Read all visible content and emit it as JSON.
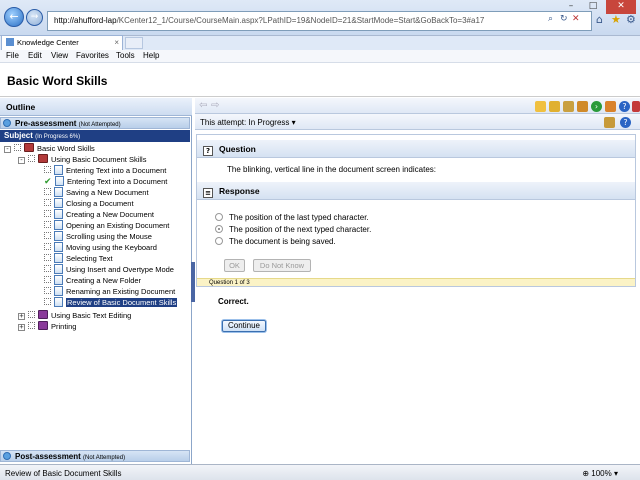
{
  "browser": {
    "url_host": "http://ahufford-lap",
    "url_rest": "/KCenter12_1/Course/CourseMain.aspx?LPathID=19&NodeID=21&StartMode=Start&GoBackTo=3#a17",
    "back_glyph": "←",
    "forward_glyph": "→",
    "tab_title": "Knowledge Center",
    "tab_close": "×",
    "window_controls": [
      "–",
      "□",
      "✕"
    ],
    "chrome_icons": [
      "search-icon",
      "refresh-icon",
      "stop-icon",
      "home-icon",
      "favorites-icon",
      "tools-icon"
    ],
    "chrome_glyphs": {
      "home": "⌂",
      "favorites": "★",
      "tools": "⚙"
    },
    "menu": [
      "File",
      "Edit",
      "View",
      "Favorites",
      "Tools",
      "Help"
    ]
  },
  "page": {
    "title": "Basic Word Skills"
  },
  "outline": {
    "header": "Outline",
    "pre_assessment": {
      "label": "Pre-assessment",
      "status": "(Not Attempted)"
    },
    "subject": {
      "label": "Subject",
      "status": "(In Progress 6%)"
    },
    "post_assessment": {
      "label": "Post-assessment",
      "status": "(Not Attempted)"
    },
    "tree": {
      "root": "Basic Word Skills",
      "chapter1": "Using Basic Document Skills",
      "lessons": [
        "Entering Text into a Document",
        "Entering Text into a Document",
        "Saving a New Document",
        "Closing a Document",
        "Creating a New Document",
        "Opening an Existing Document",
        "Scrolling using the Mouse",
        "Moving using the Keyboard",
        "Selecting Text",
        "Using Insert and Overtype Mode",
        "Creating a New Folder",
        "Renaming an Existing Document",
        "Review of Basic Document Skills"
      ],
      "chapter2": "Using Basic Text Editing",
      "chapter3": "Printing",
      "selected_index": 12
    }
  },
  "content": {
    "attempt_label": "This attempt:",
    "attempt_value": "In Progress",
    "dropdown_glyph": "▾",
    "question_header": "Question",
    "question_text": "The blinking, vertical line in the document screen indicates:",
    "response_header": "Response",
    "options": [
      "The position of the last typed character.",
      "The position of the next typed character.",
      "The document is being saved."
    ],
    "selected_option": 1,
    "ok_label": "OK",
    "dont_know_label": "Do Not Know",
    "question_counter": "Question 1 of 3",
    "result": "Correct.",
    "continue_label": "Continue"
  },
  "statusbar": {
    "text": "Review of Basic Document Skills",
    "zoom": "100%"
  },
  "colors": {
    "selection": "#1f3f84",
    "panel_border": "#8ca6c9",
    "footer_bg": "#fbf3c6"
  }
}
